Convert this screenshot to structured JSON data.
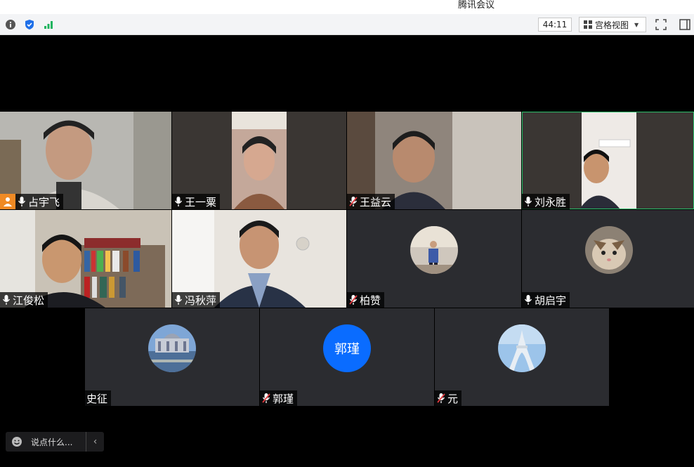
{
  "window": {
    "title": "腾讯会议"
  },
  "toolbar": {
    "timer": "44:11",
    "view_mode_label": "宫格视图",
    "icons": [
      "info-icon",
      "shield-icon",
      "signal-icon",
      "fullscreen-icon",
      "sidebar-toggle-icon"
    ]
  },
  "participants": [
    {
      "name": "占宇飞",
      "mic": "on",
      "host": true,
      "type": "video"
    },
    {
      "name": "王一粟",
      "mic": "on",
      "type": "video"
    },
    {
      "name": "王益云",
      "mic": "muted",
      "type": "video"
    },
    {
      "name": "刘永胜",
      "mic": "on",
      "type": "video",
      "speaking": true
    },
    {
      "name": "江俊松",
      "mic": "on",
      "type": "video"
    },
    {
      "name": "冯秋萍",
      "mic": "on",
      "type": "video"
    },
    {
      "name": "柏赞",
      "mic": "muted",
      "type": "avatar"
    },
    {
      "name": "胡启宇",
      "mic": "on",
      "type": "avatar"
    },
    {
      "name": "史征",
      "mic": "none",
      "type": "avatar"
    },
    {
      "name": "郭瑾",
      "mic": "muted",
      "type": "avatar",
      "avatar_text": "郭瑾"
    },
    {
      "name": "元",
      "mic": "muted",
      "type": "avatar"
    }
  ],
  "chat": {
    "placeholder": "说点什么..."
  },
  "colors": {
    "accent_blue": "#0a6cff",
    "speaking_green": "#2bbf6a",
    "host_orange": "#f08a24",
    "muted_red": "#e0393e"
  }
}
